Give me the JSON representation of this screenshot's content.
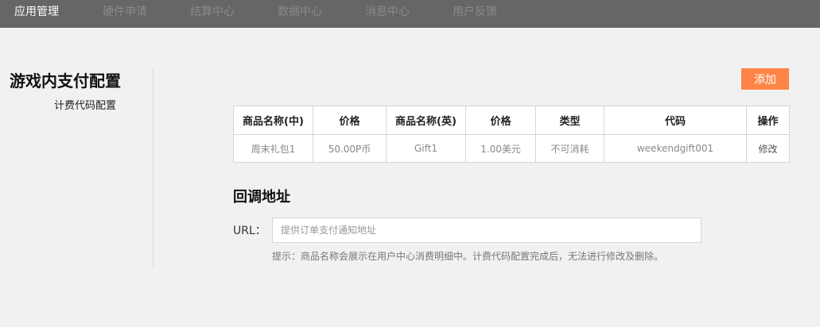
{
  "nav": {
    "items": [
      {
        "label": "应用管理"
      },
      {
        "label": "硬件申请"
      },
      {
        "label": "结算中心"
      },
      {
        "label": "数据中心"
      },
      {
        "label": "消息中心"
      },
      {
        "label": "用户反馈"
      }
    ],
    "active_index": 0
  },
  "sidebar": {
    "title": "游戏内支付配置",
    "subtitle": "计费代码配置"
  },
  "toolbar": {
    "add_label": "添加"
  },
  "table": {
    "headers": [
      "商品名称(中)",
      "价格",
      "商品名称(英)",
      "价格",
      "类型",
      "代码",
      "操作"
    ],
    "rows": [
      {
        "name_cn": "周末礼包1",
        "price_cn": "50.00P币",
        "name_en": "Gift1",
        "price_en": "1.00美元",
        "type": "不可消耗",
        "code": "weekendgift001",
        "action": "修改"
      }
    ]
  },
  "callback": {
    "title": "回调地址",
    "url_label": "URL：",
    "url_value": "",
    "url_placeholder": "提供订单支付通知地址",
    "hint": "提示：商品名称会展示在用户中心消费明细中。计费代码配置完成后，无法进行修改及删除。"
  },
  "colors": {
    "nav_bg": "#666666",
    "accent": "#ff8547",
    "page_bg": "#f1f1f1"
  }
}
